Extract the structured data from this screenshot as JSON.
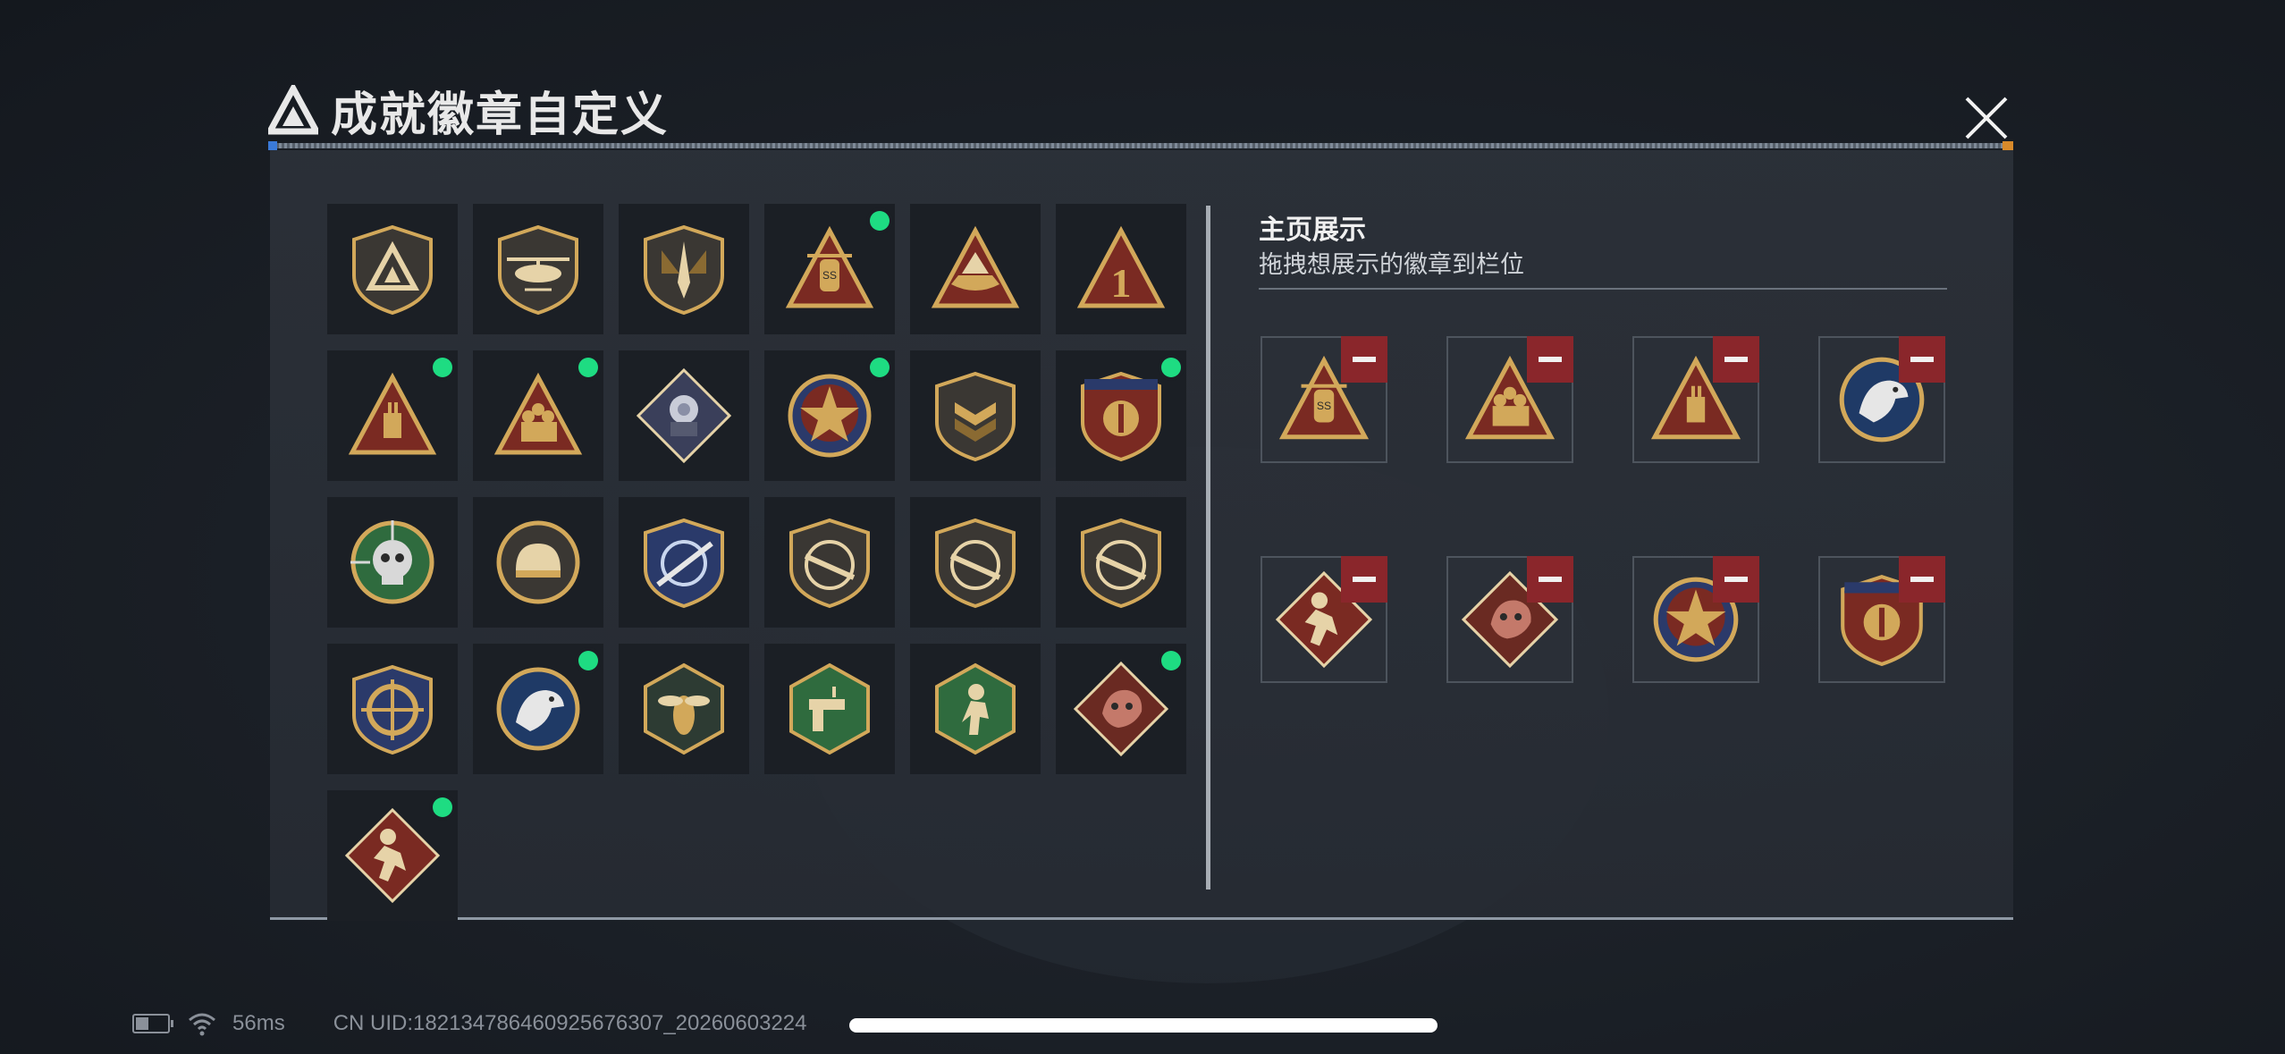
{
  "window": {
    "title": "成就徽章自定义"
  },
  "colors": {
    "accent_new": "#1edc82",
    "remove": "#8a262b",
    "gold": "#d2a85a",
    "panel": "#2c3139"
  },
  "badges": [
    {
      "icon": "triangle-shield-badge-icon",
      "new": false
    },
    {
      "icon": "helicopter-shield-badge-icon",
      "new": false
    },
    {
      "icon": "dagger-shield-badge-icon",
      "new": false
    },
    {
      "icon": "ss-triangle-badge-icon",
      "new": true
    },
    {
      "icon": "ship-triangle-badge-icon",
      "new": false
    },
    {
      "icon": "number-one-triangle-badge-icon",
      "new": false
    },
    {
      "icon": "plug-triangle-badge-icon",
      "new": true
    },
    {
      "icon": "soldiers-triangle-badge-icon",
      "new": true
    },
    {
      "icon": "flower-diamond-badge-icon",
      "new": false
    },
    {
      "icon": "star-wreath-badge-icon",
      "new": true
    },
    {
      "icon": "chevron-shield-badge-icon",
      "new": false
    },
    {
      "icon": "crest-banner-badge-icon",
      "new": true
    },
    {
      "icon": "skull-green-badge-icon",
      "new": false
    },
    {
      "icon": "helmet-round-badge-icon",
      "new": false
    },
    {
      "icon": "sniper-blue-shield-badge-icon",
      "new": false
    },
    {
      "icon": "rifle-shield-badge-icon",
      "new": false
    },
    {
      "icon": "rifle-shield-badge-icon",
      "new": false
    },
    {
      "icon": "rifle-shield-badge-icon",
      "new": false
    },
    {
      "icon": "crosshair-gold-badge-icon",
      "new": false
    },
    {
      "icon": "eagle-round-badge-icon",
      "new": true
    },
    {
      "icon": "wasp-hexagon-badge-icon",
      "new": false
    },
    {
      "icon": "pistol-hexagon-badge-icon",
      "new": false
    },
    {
      "icon": "runner-hexagon-badge-icon",
      "new": false
    },
    {
      "icon": "dragon-diamond-badge-icon",
      "new": true
    },
    {
      "icon": "runner-diamond-badge-icon",
      "new": true
    }
  ],
  "showcase": {
    "heading": "主页展示",
    "description": "拖拽想展示的徽章到栏位",
    "slots": [
      {
        "icon": "ss-triangle-badge-icon"
      },
      {
        "icon": "soldiers-triangle-badge-icon"
      },
      {
        "icon": "plug-triangle-badge-icon"
      },
      {
        "icon": "eagle-round-badge-icon"
      },
      {
        "icon": "runner-diamond-badge-icon"
      },
      {
        "icon": "dragon-diamond-badge-icon"
      },
      {
        "icon": "star-wreath-badge-icon"
      },
      {
        "icon": "crest-banner-badge-icon"
      }
    ]
  },
  "status_bar": {
    "ping": "56ms",
    "uid": "CN UID:18213478646092567630​7_20260603224"
  }
}
